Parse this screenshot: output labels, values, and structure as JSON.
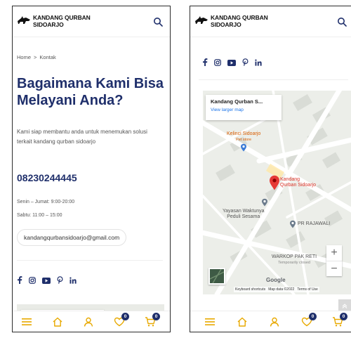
{
  "header": {
    "logo_line1": "KANDANG QURBAN",
    "logo_line2": "SIDOARJO"
  },
  "breadcrumb": {
    "home": "Home",
    "separator": ">",
    "current": "Kontak"
  },
  "hero": {
    "title": "Bagaimana Kami Bisa Melayani Anda?",
    "description": "Kami siap membantu anda untuk menemukan solusi terkait kandang qurban sidoarjo"
  },
  "contact": {
    "phone": "08230244445",
    "hours_weekday": "Senin – Jumat: 9:00-20:00",
    "hours_saturday": "Sabtu: 11:00 – 15:00",
    "email": "kandangqurbansidoarjo@gmail.com"
  },
  "socials": [
    "facebook-icon",
    "instagram-icon",
    "youtube-icon",
    "pinterest-icon",
    "linkedin-icon"
  ],
  "map": {
    "place_name": "Kandang Qurban S...",
    "larger_map": "View larger map",
    "poi_pet_line1": "Kelinci Sidoarjo",
    "poi_pet_line2": "Pet store",
    "poi_main_line1": "Kandang",
    "poi_main_line2": "Qurban Sidoarjo",
    "poi_yayasan_line1": "Yayasan Waktunya",
    "poi_yayasan_line2": "Peduli Sesama",
    "poi_pr": "PR RAJAWALI",
    "poi_warkop_line1": "WARKOP PAK RETI",
    "poi_warkop_line2": "Temporarily closed",
    "zoom_in": "+",
    "zoom_out": "−",
    "google": "Google",
    "shortcuts": "Keyboard shortcuts",
    "map_data": "Map data ©2022",
    "terms": "Terms of Use"
  },
  "nav": {
    "wishlist_count": "0",
    "cart_count": "0"
  },
  "colors": {
    "brand": "#1f2f6b",
    "accent": "#e8a900",
    "pin": "#e53935"
  }
}
